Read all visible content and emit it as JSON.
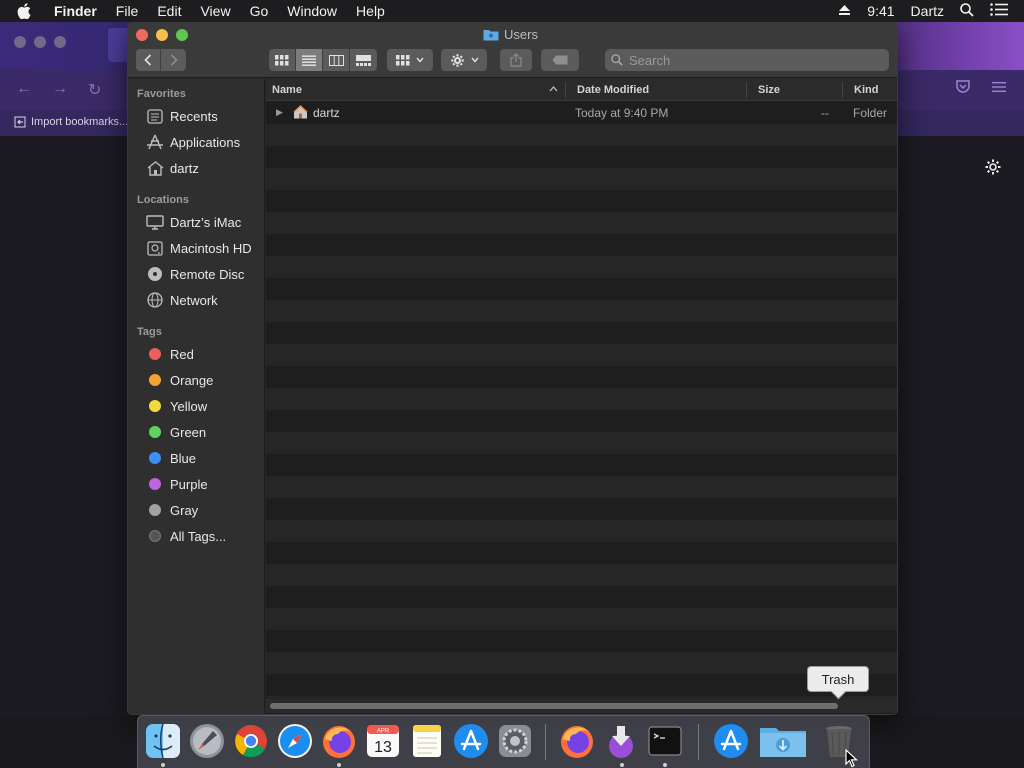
{
  "menubar": {
    "app_name": "Finder",
    "items": [
      "File",
      "Edit",
      "View",
      "Go",
      "Window",
      "Help"
    ],
    "time": "9:41",
    "user": "Dartz"
  },
  "browser": {
    "bookmark_import_label": "Import bookmarks..."
  },
  "finder": {
    "title": "Users",
    "search_placeholder": "Search",
    "sidebar": {
      "favorites_header": "Favorites",
      "favorites": [
        {
          "label": "Recents",
          "icon": "recents-icon"
        },
        {
          "label": "Applications",
          "icon": "applications-icon"
        },
        {
          "label": "dartz",
          "icon": "home-icon"
        }
      ],
      "locations_header": "Locations",
      "locations": [
        {
          "label": "Dartz’s iMac",
          "icon": "imac-icon"
        },
        {
          "label": "Macintosh HD",
          "icon": "hard-drive-icon"
        },
        {
          "label": "Remote Disc",
          "icon": "disc-icon"
        },
        {
          "label": "Network",
          "icon": "network-icon"
        }
      ],
      "tags_header": "Tags",
      "tags": [
        {
          "label": "Red",
          "color": "#ec5f5a"
        },
        {
          "label": "Orange",
          "color": "#f6a335"
        },
        {
          "label": "Yellow",
          "color": "#f3d93c"
        },
        {
          "label": "Green",
          "color": "#5dd45f"
        },
        {
          "label": "Blue",
          "color": "#3d8ef6"
        },
        {
          "label": "Purple",
          "color": "#c065e0"
        },
        {
          "label": "Gray",
          "color": "#a1a1a1"
        },
        {
          "label": "All Tags...",
          "color": "#555555"
        }
      ]
    },
    "columns": {
      "name": "Name",
      "date_modified": "Date Modified",
      "size": "Size",
      "kind": "Kind"
    },
    "files": [
      {
        "name": "dartz",
        "date_modified": "Today at 9:40 PM",
        "size": "--",
        "kind": "Folder"
      }
    ]
  },
  "tooltip": "Trash",
  "dock": {
    "apps": [
      "Finder",
      "Launchpad",
      "Chrome",
      "Safari",
      "Firefox",
      "Calendar",
      "Notes",
      "App Store",
      "System Preferences",
      "Firefox",
      "Downloader",
      "Terminal",
      "App Store",
      "Downloads",
      "Trash"
    ],
    "calendar_month": "APR",
    "calendar_day": "13"
  }
}
